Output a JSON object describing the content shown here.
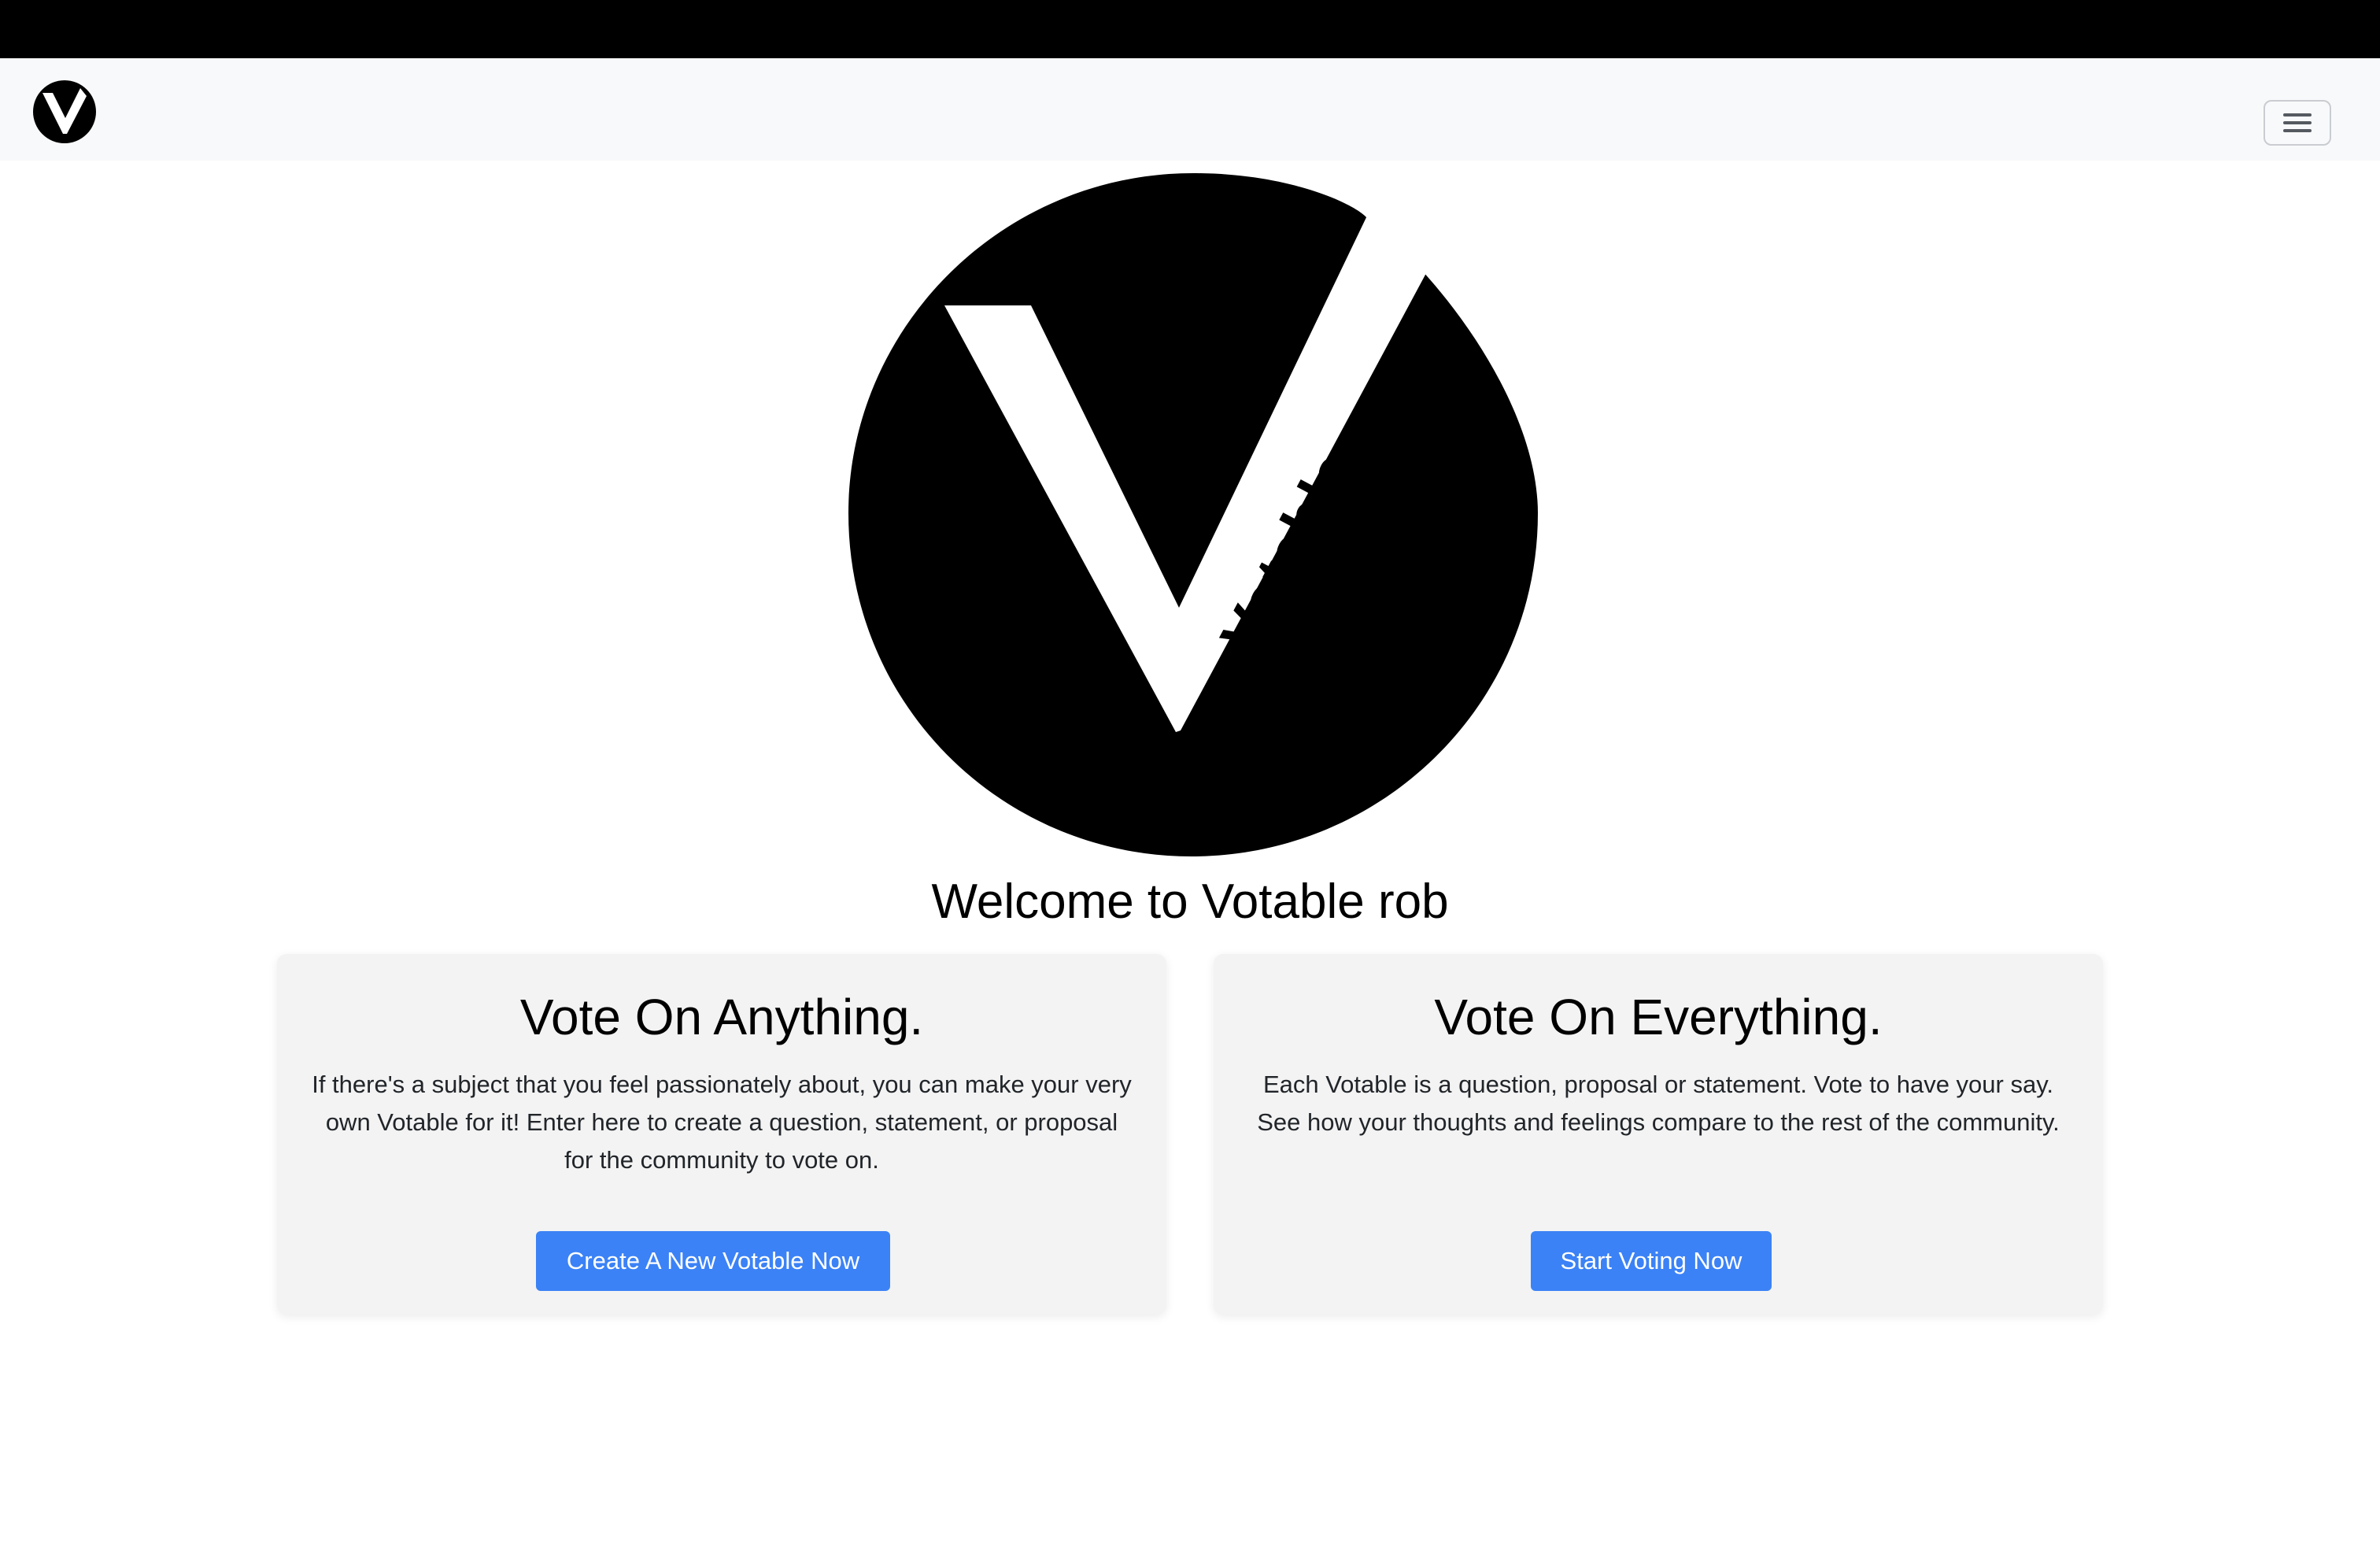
{
  "navbar": {
    "logo_icon": "votable-v-logo-icon",
    "menu_icon": "hamburger-menu-icon"
  },
  "hero": {
    "logo_text": "Votable",
    "welcome": "Welcome to Votable rob"
  },
  "cards": [
    {
      "title": "Vote On Anything.",
      "body": "If there's a subject that you feel passionately about, you can make your very own Votable for it! Enter here to create a question, statement, or proposal for the community to vote on.",
      "button": "Create A New Votable Now"
    },
    {
      "title": "Vote On Everything.",
      "body": "Each Votable is a question, proposal or statement. Vote to have your say. See how your thoughts and feelings compare to the rest of the community.",
      "button": "Start Voting Now"
    }
  ],
  "colors": {
    "primary_button": "#3b82f6",
    "navbar_bg": "#f8f9fa",
    "card_bg": "#f3f3f3"
  }
}
